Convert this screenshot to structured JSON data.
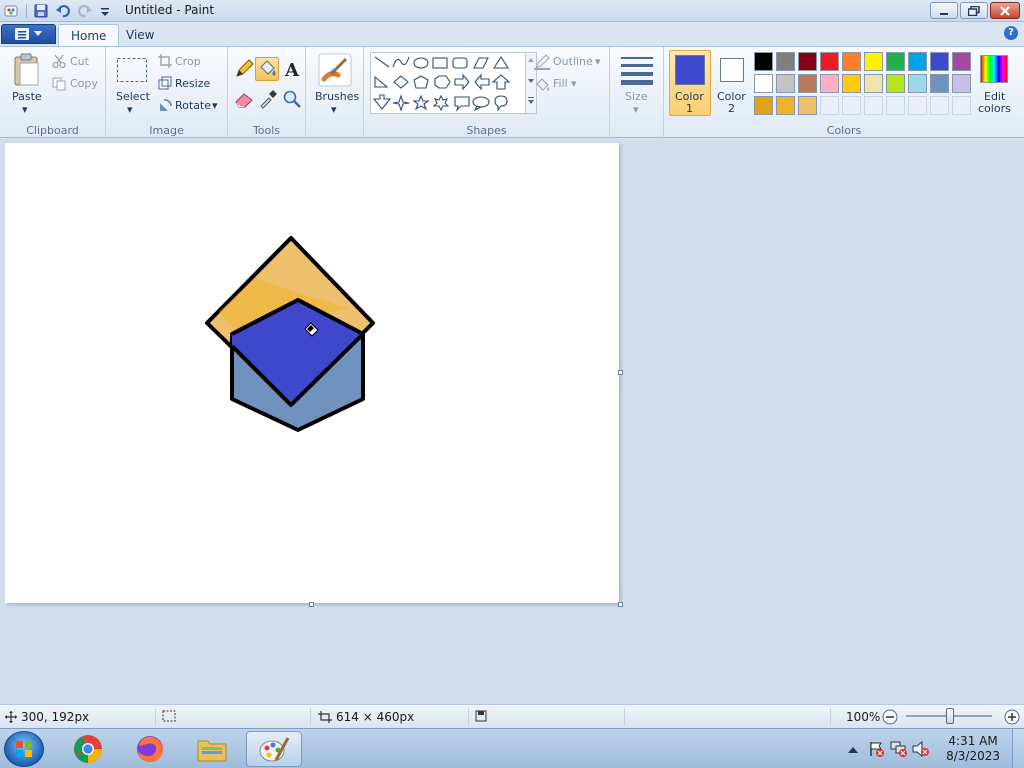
{
  "window": {
    "title": "Untitled - Paint"
  },
  "tabs": [
    {
      "label": "Home"
    },
    {
      "label": "View"
    }
  ],
  "ribbon": {
    "clipboard": {
      "label": "Clipboard",
      "paste": "Paste",
      "cut": "Cut",
      "copy": "Copy"
    },
    "image": {
      "label": "Image",
      "select": "Select",
      "crop": "Crop",
      "resize": "Resize",
      "rotate": "Rotate"
    },
    "tools": {
      "label": "Tools"
    },
    "brushes": {
      "label": "Brushes"
    },
    "shapes": {
      "label": "Shapes",
      "outline": "Outline",
      "fill": "Fill"
    },
    "size": {
      "label": "Size"
    },
    "colors": {
      "label": "Colors",
      "color1_line1": "Color",
      "color1_line2": "1",
      "color2_line1": "Color",
      "color2_line2": "2",
      "edit_line1": "Edit",
      "edit_line2": "colors",
      "color1_value": "#3f48cc",
      "color2_value": "#ffffff",
      "palette_row1": [
        "#000000",
        "#7f7f7f",
        "#880015",
        "#ed1c24",
        "#ff7f27",
        "#fff200",
        "#22b14c",
        "#00a2e8",
        "#3f48cc",
        "#a349a4"
      ],
      "palette_row2": [
        "#ffffff",
        "#c3c3c3",
        "#b97a57",
        "#ffaec9",
        "#ffc90e",
        "#efe4b0",
        "#b5e61d",
        "#99d9ea",
        "#7092be",
        "#c8bfe7"
      ],
      "palette_row3": [
        "#e2a11b",
        "#f0b22d",
        "#ecc06c",
        "",
        "",
        "",
        "",
        "",
        "",
        ""
      ]
    }
  },
  "canvas": {
    "shapes": {
      "diamond_fill": "#ecc06c",
      "hexagon_fill": "#7092be",
      "overlap_fill": "#3f48cc",
      "stroke": "#000000"
    }
  },
  "status": {
    "cursor_pos": "300, 192px",
    "canvas_size": "614 × 460px",
    "zoom": "100%"
  },
  "taskbar": {
    "time": "4:31 AM",
    "date": "8/3/2023"
  }
}
